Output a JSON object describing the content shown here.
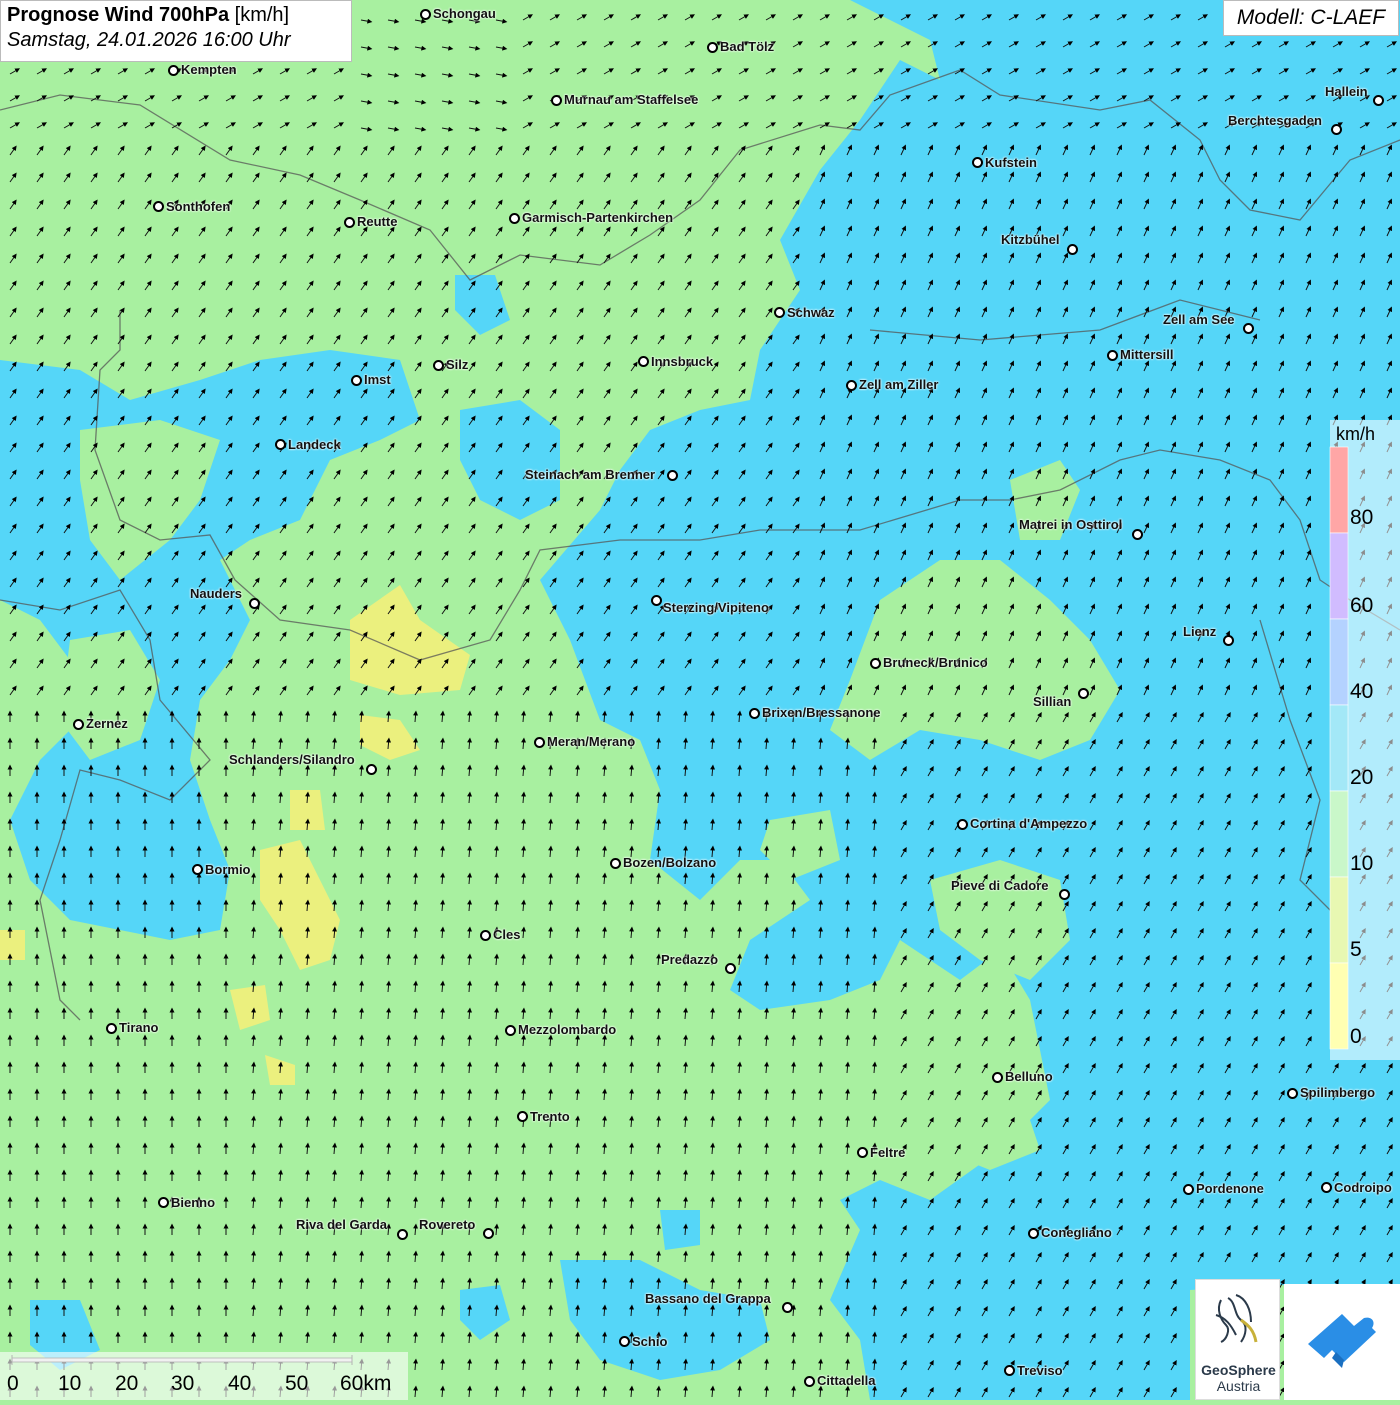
{
  "title": {
    "bold": "Prognose Wind 700hPa",
    "unit": "[km/h]",
    "datetime": "Samstag, 24.01.2026 16:00 Uhr"
  },
  "model": "Modell: C-LAEF",
  "legend": {
    "unit": "km/h",
    "labels": [
      "80",
      "60",
      "40",
      "20",
      "10",
      "5",
      "0"
    ],
    "bands": [
      {
        "from": 80,
        "color": "#ff3b3b"
      },
      {
        "from": 60,
        "color": "#9a6bff"
      },
      {
        "from": 40,
        "color": "#5a9bff"
      },
      {
        "from": 20,
        "color": "#33ccee"
      },
      {
        "from": 10,
        "color": "#88ee88"
      },
      {
        "from": 5,
        "color": "#ccf055"
      },
      {
        "from": 0,
        "color": "#ffff55"
      }
    ]
  },
  "scale_bar": {
    "labels": [
      "0",
      "10",
      "20",
      "30",
      "40",
      "50",
      "60km"
    ]
  },
  "logos": {
    "geosphere_line1": "GeoSphere",
    "geosphere_line2": "Austria"
  },
  "colors": {
    "low_wind": "#a8f0a0",
    "mid_wind": "#55d6f8",
    "calm": "#f2f07a"
  },
  "cities": [
    {
      "name": "Schongau"
    },
    {
      "name": "Bad Tölz"
    },
    {
      "name": "Kempten"
    },
    {
      "name": "Murnau am Staffelsee"
    },
    {
      "name": "Hallein"
    },
    {
      "name": "Berchtesgaden"
    },
    {
      "name": "Kufstein"
    },
    {
      "name": "Sonthofen"
    },
    {
      "name": "Reutte"
    },
    {
      "name": "Garmisch-Partenkirchen"
    },
    {
      "name": "Kitzbühel"
    },
    {
      "name": "Schwaz"
    },
    {
      "name": "Zell am See"
    },
    {
      "name": "Mittersill"
    },
    {
      "name": "Imst"
    },
    {
      "name": "Silz"
    },
    {
      "name": "Innsbruck"
    },
    {
      "name": "Zell am Ziller"
    },
    {
      "name": "Landeck"
    },
    {
      "name": "Steinach am Brenner"
    },
    {
      "name": "Matrei in Osttirol"
    },
    {
      "name": "Nauders"
    },
    {
      "name": "Sterzing/Vipiteno"
    },
    {
      "name": "Lienz"
    },
    {
      "name": "Bruneck/Brunico"
    },
    {
      "name": "Sillian"
    },
    {
      "name": "Zernez"
    },
    {
      "name": "Brixen/Bressanone"
    },
    {
      "name": "Meran/Merano"
    },
    {
      "name": "Schlanders/Silandro"
    },
    {
      "name": "Cortina d'Ampezzo"
    },
    {
      "name": "Bozen/Bolzano"
    },
    {
      "name": "Bormio"
    },
    {
      "name": "Pieve di Cadore"
    },
    {
      "name": "Cles"
    },
    {
      "name": "Predazzo"
    },
    {
      "name": "Tirano"
    },
    {
      "name": "Mezzolombardo"
    },
    {
      "name": "Belluno"
    },
    {
      "name": "Spilimbergo"
    },
    {
      "name": "Trento"
    },
    {
      "name": "Feltre"
    },
    {
      "name": "Pordenone"
    },
    {
      "name": "Codroipo"
    },
    {
      "name": "Bienno"
    },
    {
      "name": "Riva del Garda"
    },
    {
      "name": "Rovereto"
    },
    {
      "name": "Conegliano"
    },
    {
      "name": "Bassano del Grappa"
    },
    {
      "name": "Schio"
    },
    {
      "name": "Treviso"
    },
    {
      "name": "Cittadella"
    }
  ]
}
